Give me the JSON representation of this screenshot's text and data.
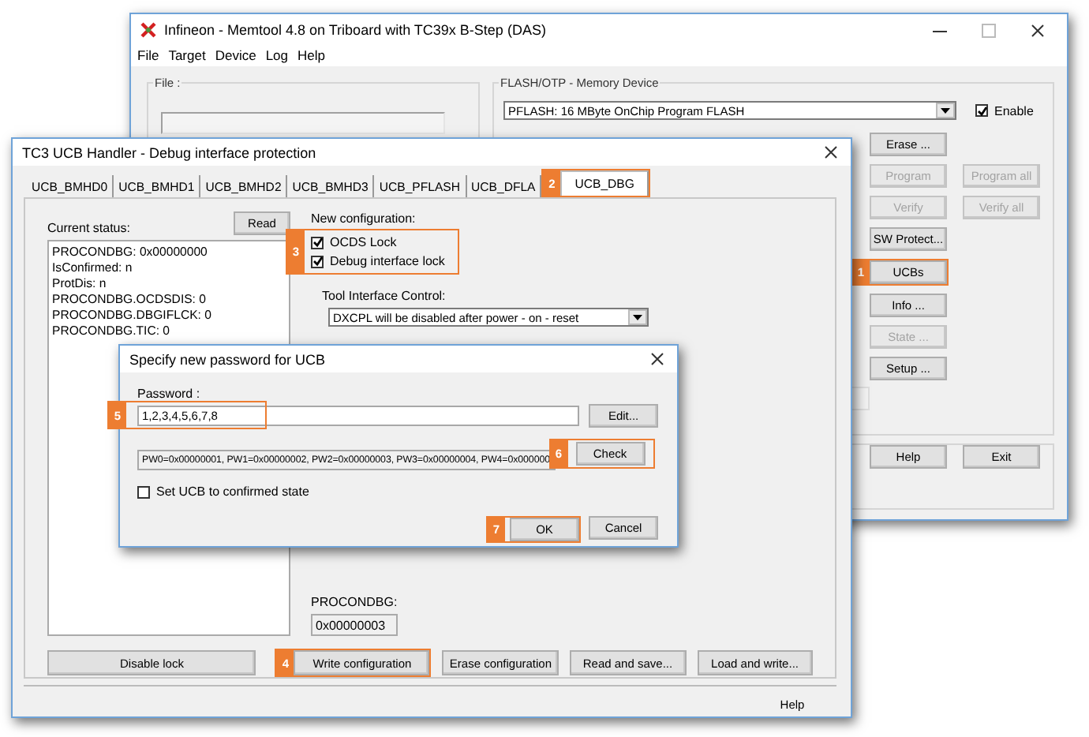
{
  "main_window": {
    "title": "Infineon - Memtool 4.8 on Triboard with TC39x B-Step (DAS)",
    "menu": [
      "File",
      "Target",
      "Device",
      "Log",
      "Help"
    ],
    "file_group": {
      "label": "File :"
    },
    "flash_group": {
      "label": "FLASH/OTP - Memory Device",
      "device": "PFLASH: 16 MByte OnChip Program FLASH",
      "enable": {
        "label": "Enable",
        "checked": true
      },
      "button_rows": [
        [
          {
            "label": "Erase ...",
            "disabled": false
          }
        ],
        [
          {
            "label": "Program",
            "disabled": true
          },
          {
            "label": "Program all",
            "disabled": true
          }
        ],
        [
          {
            "label": "Verify",
            "disabled": true
          },
          {
            "label": "Verify all",
            "disabled": true
          }
        ],
        [
          {
            "label": "SW Protect...",
            "disabled": false
          }
        ],
        [
          {
            "label": "UCBs",
            "disabled": false,
            "callout": "1"
          }
        ],
        [
          {
            "label": "Info ...",
            "disabled": false
          }
        ],
        [
          {
            "label": "State ...",
            "disabled": true
          }
        ],
        [
          {
            "label": "Setup ...",
            "disabled": false
          }
        ]
      ]
    },
    "bottom_buttons": [
      "Help",
      "Exit"
    ]
  },
  "ucb_window": {
    "title": "TC3 UCB Handler - Debug interface protection",
    "tabs": [
      {
        "label": "UCB_BMHD0",
        "selected": false
      },
      {
        "label": "UCB_BMHD1",
        "selected": false
      },
      {
        "label": "UCB_BMHD2",
        "selected": false
      },
      {
        "label": "UCB_BMHD3",
        "selected": false
      },
      {
        "label": "UCB_PFLASH",
        "selected": false
      },
      {
        "label": "UCB_DFLA",
        "selected": false
      },
      {
        "label": "UCB_DBG",
        "selected": true,
        "callout": "2"
      }
    ],
    "status_label": "Current status:",
    "read_button": "Read",
    "status_lines": [
      "PROCONDBG: 0x00000000",
      "IsConfirmed: n",
      "ProtDis: n",
      "PROCONDBG.OCDSDIS: 0",
      "PROCONDBG.DBGIFLCK: 0",
      "PROCONDBG.TIC: 0"
    ],
    "new_config_label": "New configuration:",
    "lock_options": {
      "callout": "3",
      "items": [
        {
          "label": "OCDS Lock",
          "checked": true
        },
        {
          "label": "Debug interface lock",
          "checked": true
        }
      ]
    },
    "tool_interface_label": "Tool Interface Control:",
    "tool_interface_value": "DXCPL will be disabled after power - on - reset",
    "procondbg_label": "PROCONDBG:",
    "procondbg_value": "0x00000003",
    "buttons": [
      {
        "label": "Disable lock"
      },
      {
        "label": "Write configuration",
        "callout": "4"
      },
      {
        "label": "Erase configuration"
      },
      {
        "label": "Read and save..."
      },
      {
        "label": "Load and write..."
      }
    ],
    "help_button": "Help"
  },
  "password_dialog": {
    "title": "Specify new password for UCB",
    "password_label": "Password :",
    "password": "1,2,3,4,5,6,7,8",
    "password_callout": "5",
    "edit_button": "Edit...",
    "password_words": "PW0=0x00000001, PW1=0x00000002, PW2=0x00000003, PW3=0x00000004, PW4=0x000000",
    "check_button": {
      "label": "Check",
      "callout": "6"
    },
    "confirm": {
      "label": "Set UCB to confirmed state",
      "checked": false
    },
    "ok_button": {
      "label": "OK",
      "callout": "7"
    },
    "cancel_button": "Cancel"
  }
}
